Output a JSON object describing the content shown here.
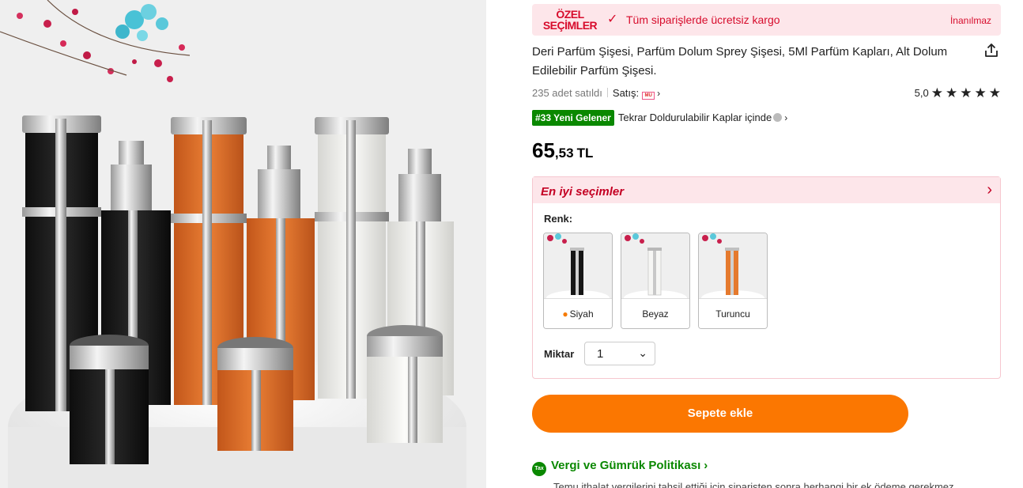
{
  "promo": {
    "logo_line1": "ÖZEL",
    "logo_line2": "SEÇİMLER",
    "text": "Tüm siparişlerde ücretsiz kargo",
    "link": "İnanılmaz"
  },
  "product": {
    "title": "Deri Parfüm Şişesi, Parfüm Dolum Sprey Şişesi, 5Ml Parfüm Kapları, Alt Dolum Edilebilir Parfüm Şişesi.",
    "sold": "235 adet satıldı",
    "seller_label": "Satış:",
    "seller_logo": "MU",
    "rating": "5,0",
    "stars": 5,
    "rank_badge": "#33 Yeni Gelener",
    "rank_text": "Tekrar Doldurulabilir Kaplar içinde",
    "price_int": "65",
    "price_dec": ",53",
    "currency": "TL"
  },
  "best_picks": {
    "title": "En iyi seçimler",
    "color_label": "Renk:",
    "colors": [
      {
        "label": "Siyah",
        "hex": "#1a1a1a"
      },
      {
        "label": "Beyaz",
        "hex": "#f2f2f0"
      },
      {
        "label": "Turuncu",
        "hex": "#e57a2e"
      }
    ],
    "quantity_label": "Miktar",
    "quantity_value": "1"
  },
  "cart": {
    "button": "Sepete ekle"
  },
  "tax": {
    "icon_text": "Tax",
    "title": "Vergi ve Gümrük Politikası",
    "desc": "Temu ithalat vergilerini tahsil ettiği için siparişten sonra herhangi bir ek ödeme gerekmez."
  },
  "colors": {
    "accent_orange": "#fb7701",
    "promo_red": "#d70c2c",
    "tax_green": "#0a8800",
    "promo_bg": "#fde6ea"
  }
}
